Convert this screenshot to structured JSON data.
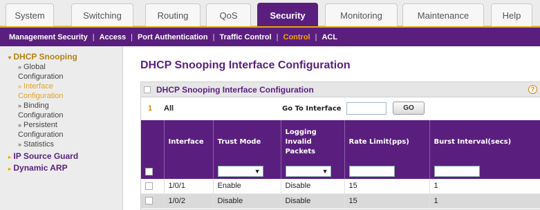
{
  "top_tabs": [
    "System",
    "Switching",
    "Routing",
    "QoS",
    "Security",
    "Monitoring",
    "Maintenance",
    "Help"
  ],
  "active_tab": "Security",
  "sub_nav": [
    "Management Security",
    "Access",
    "Port Authentication",
    "Traffic Control",
    "Control",
    "ACL"
  ],
  "active_sub": "Control",
  "sidebar": {
    "section": "DHCP Snooping",
    "items": [
      {
        "line1": "Global",
        "line2": "Configuration"
      },
      {
        "line1": "Interface",
        "line2": "Configuration"
      },
      {
        "line1": "Binding",
        "line2": "Configuration"
      },
      {
        "line1": "Persistent",
        "line2": "Configuration"
      },
      {
        "line1": "Statistics",
        "line2": ""
      }
    ],
    "other_sections": [
      "IP Source Guard",
      "Dynamic ARP"
    ]
  },
  "page_title": "DHCP Snooping Interface Configuration",
  "panel": {
    "title": "DHCP Snooping Interface Configuration",
    "count": "1",
    "all_label": "All",
    "goto_label": "Go To Interface",
    "go_button": "GO"
  },
  "table": {
    "headers": [
      "Interface",
      "Trust Mode",
      "Logging Invalid Packets",
      "Rate Limit(pps)",
      "Burst Interval(secs)"
    ],
    "rows": [
      {
        "interface": "1/0/1",
        "trust_mode": "Enable",
        "logging": "Disable",
        "rate_limit": "15",
        "burst": "1"
      },
      {
        "interface": "1/0/2",
        "trust_mode": "Disable",
        "logging": "Disable",
        "rate_limit": "15",
        "burst": "1"
      }
    ]
  },
  "colors": {
    "brand_purple": "#5a1f7e",
    "accent_orange": "#e9a700"
  }
}
